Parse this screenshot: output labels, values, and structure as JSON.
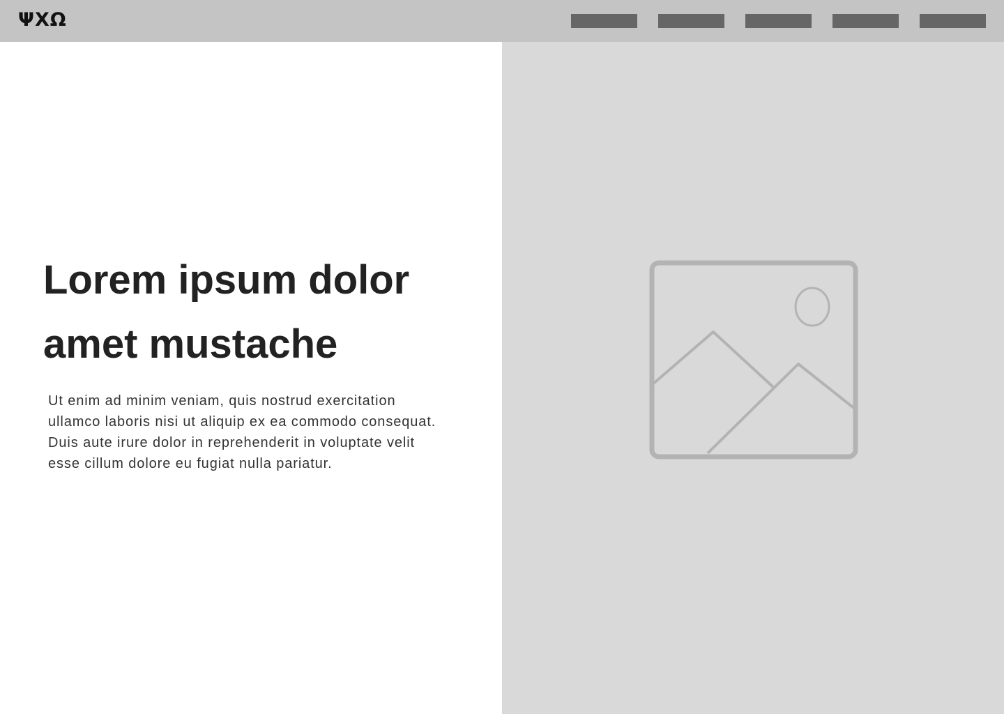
{
  "header": {
    "logo_text": "ΨΧΩ",
    "nav_items": [
      "",
      "",
      "",
      "",
      ""
    ]
  },
  "hero": {
    "title_line_1": "Lorem ipsum dolor",
    "title_line_2": "amet mustache",
    "body_lines": [
      "Ut enim ad minim veniam, quis nostrud exercitation",
      "ullamco laboris nisi ut aliquip ex ea commodo consequat.",
      "Duis aute irure dolor in reprehenderit in voluptate velit",
      "esse cillum dolore eu fugiat nulla pariatur."
    ],
    "image_icon": "image-placeholder-icon"
  },
  "colors": {
    "header_bg": "#c4c4c4",
    "nav_placeholder": "#666666",
    "image_panel_bg": "#d9d9d9",
    "icon_stroke": "#b3b3b3",
    "heading_text": "#222222"
  }
}
